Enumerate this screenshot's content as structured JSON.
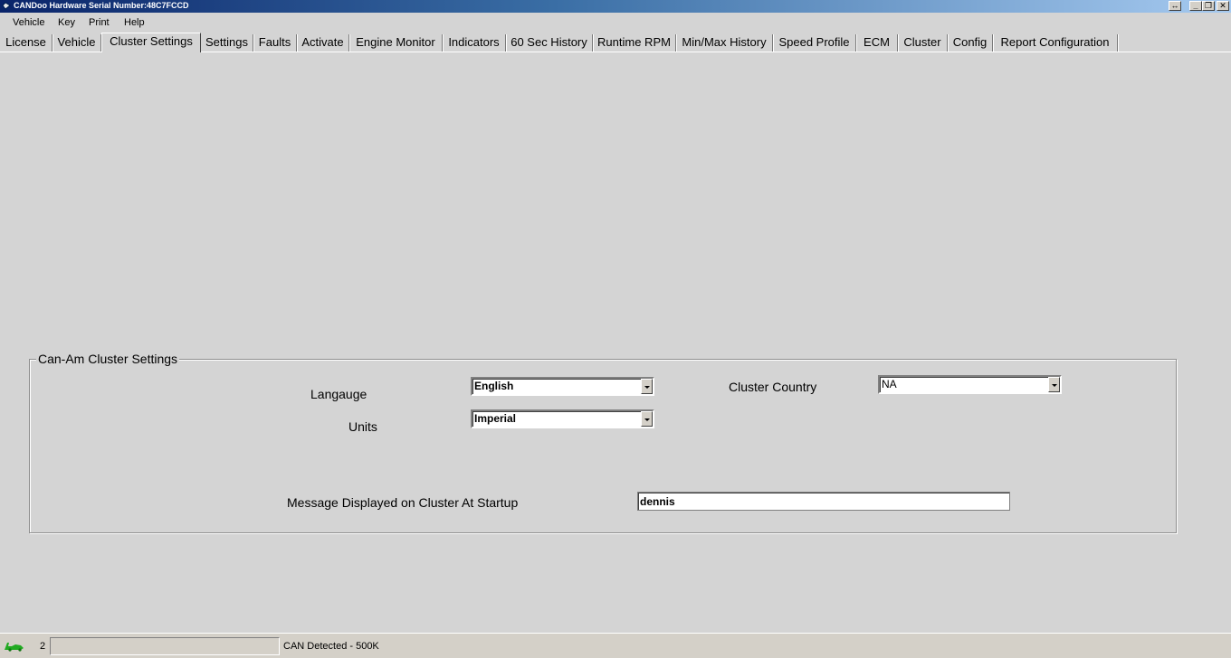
{
  "window": {
    "title": "CANDoo  Hardware Serial Number:48C7FCCD",
    "controls": {
      "swap": "↔",
      "minimize": "_",
      "restore": "❐",
      "close": "✕"
    }
  },
  "menu": {
    "items": [
      "Vehicle",
      "Key",
      "Print",
      "Help"
    ]
  },
  "tabs": {
    "items": [
      "License",
      "Vehicle",
      "Cluster Settings",
      "Settings",
      "Faults",
      "Activate",
      "Engine Monitor",
      "Indicators",
      "60 Sec History",
      "Runtime RPM",
      "Min/Max History",
      "Speed Profile",
      "ECM",
      "Cluster",
      "Config",
      "Report Configuration"
    ],
    "active": "Cluster Settings"
  },
  "cluster_settings": {
    "group_title": "Can-Am Cluster Settings",
    "language": {
      "label": "Langauge",
      "value": "English"
    },
    "units": {
      "label": "Units",
      "value": "Imperial"
    },
    "cluster_country": {
      "label": "Cluster Country",
      "value": "NA"
    },
    "startup_message": {
      "label": "Message Displayed on Cluster At Startup",
      "value": "dennis"
    }
  },
  "status": {
    "count": "2",
    "progress_text": "",
    "can_status": "CAN Detected - 500K",
    "icon": "green-car-icon"
  }
}
